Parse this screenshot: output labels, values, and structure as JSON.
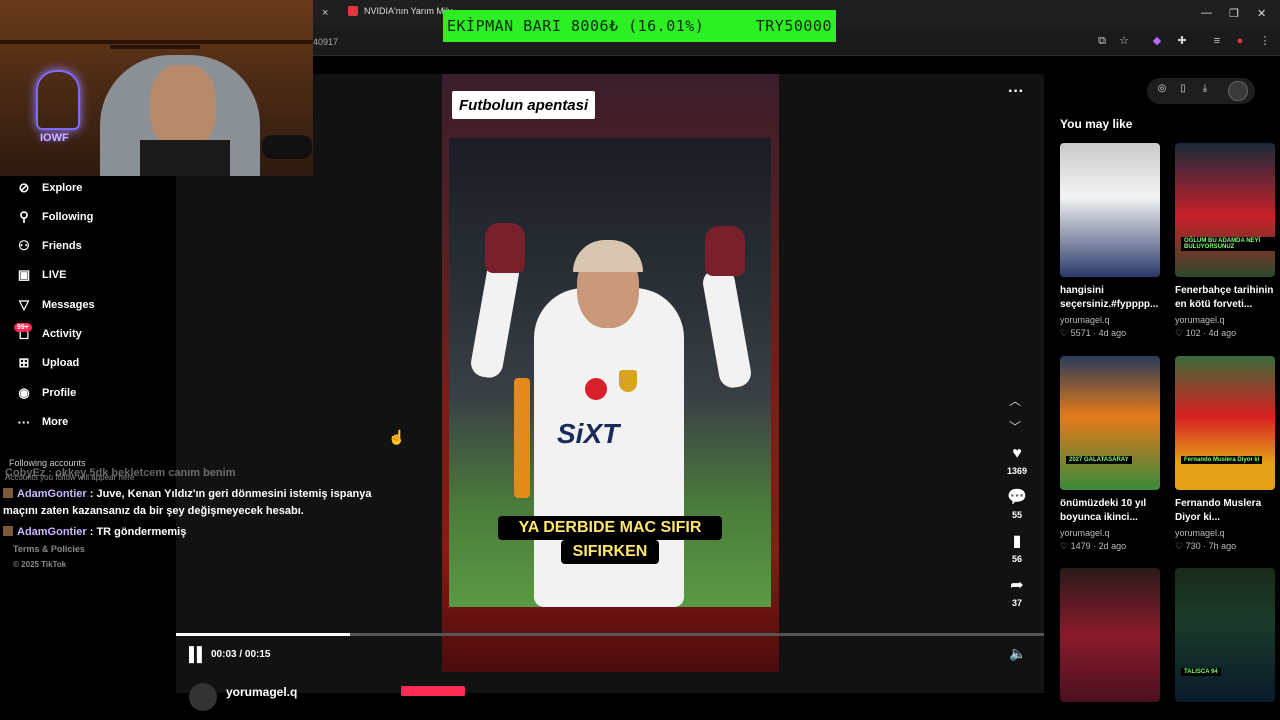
{
  "browser": {
    "tab_title": "NVIDIA'nın Yarım Mily",
    "address_fragment": "40917",
    "tab_close": "×"
  },
  "banner": {
    "left_text": "EKİPMAN BARI 8006₺ (16.01%)",
    "right_text": "TRY50000"
  },
  "webcam": {
    "neon_text": "IOWF"
  },
  "nav": {
    "items": [
      {
        "label": "Explore",
        "icon": "compass-icon"
      },
      {
        "label": "Following",
        "icon": "user-following-icon"
      },
      {
        "label": "Friends",
        "icon": "friends-icon"
      },
      {
        "label": "LIVE",
        "icon": "live-icon"
      },
      {
        "label": "Messages",
        "icon": "messages-icon"
      },
      {
        "label": "Activity",
        "icon": "activity-icon"
      },
      {
        "label": "Upload",
        "icon": "upload-icon"
      },
      {
        "label": "Profile",
        "icon": "profile-icon"
      },
      {
        "label": "More",
        "icon": "more-icon"
      }
    ],
    "activity_badge": "99+",
    "following_accounts_heading": "Following accounts",
    "following_accounts_sub": "Accounts you follow will appear here",
    "terms": "Terms & Policies",
    "copyright": "© 2025 TikTok"
  },
  "chat": {
    "faded_line": "CobyEz : okkey 5dk bekletcem canım benim",
    "messages": [
      {
        "user": "AdamGontier",
        "text": " : Juve, Kenan Yıldız'ın geri dönmesini istemiş ispanya"
      },
      {
        "user": "",
        "text": "maçını zaten kazansanız da bir şey değişmeyecek hesabı."
      },
      {
        "user": "AdamGontier",
        "text": " : TR göndermemiş"
      }
    ]
  },
  "video": {
    "title": "Futbolun apentasi",
    "caption_line1": "YA DERBIDE MAC SIFIR",
    "caption_line2": "SIFIRKEN",
    "sponsor": "SiXT",
    "time": "00:03 / 00:15",
    "progress_fraction": 0.2,
    "likes": "1369",
    "comments": "55",
    "saves": "56",
    "shares": "37",
    "author": "yorumagel.q"
  },
  "right": {
    "heading": "You may like",
    "cards": [
      {
        "title": "hangisini seçersiniz.#fypppp...",
        "author": "yorumagel.q",
        "meta": "♡ 5571 · 4d ago",
        "tag": "",
        "bg": "linear-gradient(180deg,#c9c9c9,#f4f4f4 40%,#2a3a6a)"
      },
      {
        "title": "Fenerbahçe tarihinin en kötü forveti...",
        "author": "yorumagel.q",
        "meta": "♡ 102 · 4d ago",
        "tag": "OĞLUM BU ADAMDA NEYİ BULUYORSUNUZ",
        "bg": "linear-gradient(180deg,#1a2a3a,#c8202a 55%,#2a4a2a)"
      },
      {
        "title": "önümüzdeki 10 yıl boyunca ikinci...",
        "author": "yorumagel.q",
        "meta": "♡ 1479 · 2d ago",
        "tag": "2027 GALATASARAY",
        "bg": "linear-gradient(180deg,#2a3a5a,#e57a1a 45%,#3a8a3a)"
      },
      {
        "title": "Fernando Muslera Diyor ki...",
        "author": "yorumagel.q",
        "meta": "♡ 730 · 7h ago",
        "tag": "Fernando Muslera Diyor ki",
        "bg": "linear-gradient(180deg,#3a6a3a,#d82020 45%,#e5a01a 80%)"
      },
      {
        "title": "",
        "author": "",
        "meta": "",
        "tag": "",
        "bg": "linear-gradient(180deg,#2a1a1a,#8a1a2a 50%,#4a1020)"
      },
      {
        "title": "",
        "author": "",
        "meta": "",
        "tag": "TALISCA 94",
        "bg": "linear-gradient(180deg,#1a2a1a,#1a3a2a 40%,#0a1a2a)"
      }
    ]
  },
  "colors": {
    "banner_bg": "#2cf024",
    "accent": "#fe2c55",
    "caption_text": "#ffe56e"
  }
}
